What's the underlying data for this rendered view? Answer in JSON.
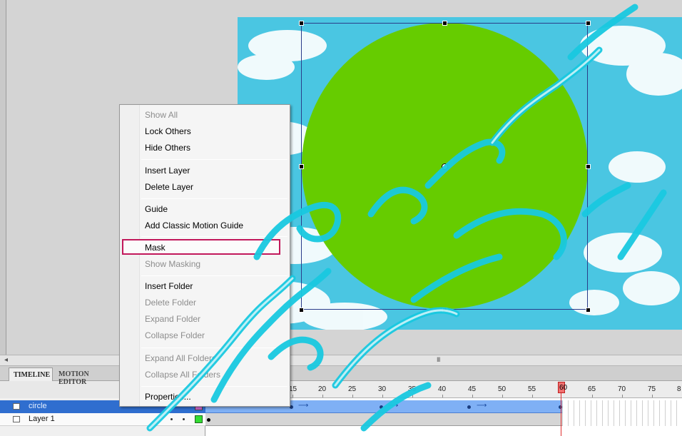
{
  "timeline": {
    "tabs": [
      {
        "label": "TIMELINE"
      },
      {
        "label": "MOTION EDITOR"
      }
    ],
    "ruler_labels": [
      "15",
      "20",
      "25",
      "30",
      "35",
      "40",
      "45",
      "50",
      "55",
      "60",
      "65",
      "70",
      "75",
      "8"
    ],
    "current_frame": "60",
    "layers": [
      {
        "name": "circle",
        "selected": true,
        "color": "#cc66cc"
      },
      {
        "name": "Layer 1",
        "selected": false,
        "color": "#33dd33"
      }
    ]
  },
  "scrollbar": {
    "left_arrow": "◂",
    "grip": "III"
  },
  "stage": {
    "background": "#49c4e0",
    "shape_color": "#66cc00"
  },
  "context_menu": {
    "items": [
      {
        "label": "Show All",
        "enabled": false
      },
      {
        "label": "Lock Others",
        "enabled": true
      },
      {
        "label": "Hide Others",
        "enabled": true
      },
      {
        "label": "Insert Layer",
        "enabled": true
      },
      {
        "label": "Delete Layer",
        "enabled": true
      },
      {
        "label": "Guide",
        "enabled": true
      },
      {
        "label": "Add Classic Motion Guide",
        "enabled": true
      },
      {
        "label": "Mask",
        "enabled": true,
        "highlighted": true
      },
      {
        "label": "Show Masking",
        "enabled": false
      },
      {
        "label": "Insert Folder",
        "enabled": true
      },
      {
        "label": "Delete Folder",
        "enabled": false
      },
      {
        "label": "Expand Folder",
        "enabled": false
      },
      {
        "label": "Collapse Folder",
        "enabled": false
      },
      {
        "label": "Expand All Folders",
        "enabled": false
      },
      {
        "label": "Collapse All Folders",
        "enabled": false
      },
      {
        "label": "Properties...",
        "enabled": true
      }
    ]
  }
}
